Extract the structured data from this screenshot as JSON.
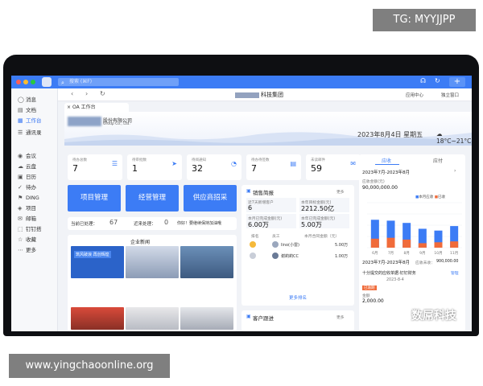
{
  "overlay": {
    "tg_label": "TG: MYYJJPP",
    "site_url": "www.yingchaoonline.org",
    "watermark_text": "数屌科技"
  },
  "titlebar": {
    "search_placeholder": "搜索 (⌘F)",
    "plus_label": "+",
    "accent_color": "#3c7cf5"
  },
  "sidebar": {
    "items": [
      {
        "label": "消息",
        "icon": "message-icon"
      },
      {
        "label": "文档",
        "icon": "document-icon"
      },
      {
        "label": "工作台",
        "icon": "workbench-icon",
        "active": true
      },
      {
        "label": "通讯录",
        "icon": "contacts-icon"
      },
      {
        "label": "会议",
        "icon": "meeting-icon"
      },
      {
        "label": "云盘",
        "icon": "cloud-icon"
      },
      {
        "label": "日历",
        "icon": "calendar-icon"
      },
      {
        "label": "待办",
        "icon": "todo-icon"
      },
      {
        "label": "DING",
        "icon": "ding-icon"
      },
      {
        "label": "项目",
        "icon": "project-icon"
      },
      {
        "label": "邮箱",
        "icon": "mail-icon"
      },
      {
        "label": "钉钉搭",
        "icon": "builder-icon"
      },
      {
        "label": "收藏",
        "icon": "star-icon"
      },
      {
        "label": "更多",
        "icon": "more-icon"
      }
    ]
  },
  "navbar": {
    "title": "科技集团",
    "app_center": "应用中心",
    "toggle_label": "独立窗口"
  },
  "tab": {
    "label": "OA 工作台"
  },
  "banner": {
    "company_name": "股份有限公司",
    "company_sub": "Group Co., Ltd.",
    "date": "2023年8月4日 星期五",
    "weather": "18°C~21°C"
  },
  "stats": [
    {
      "label": "待办总数",
      "value": "7"
    },
    {
      "label": "待审批数",
      "value": "1"
    },
    {
      "label": "待阅通知",
      "value": "32"
    },
    {
      "label": "待办待签数",
      "value": "7"
    },
    {
      "label": "未读邮件",
      "value": "59"
    }
  ],
  "buttons": {
    "project": "项目管理",
    "operation": "经营管理",
    "supplier": "供应商招采"
  },
  "todo_bar": {
    "done_label": "当前已处理：",
    "done_value": "67",
    "recent_label": "近来处理：",
    "recent_value": "0",
    "tip": "你好！要继续保持加油哦"
  },
  "news": {
    "title": "企业新闻",
    "banner_text": "筑风破浪 再创辉煌"
  },
  "sales": {
    "title": "销售简报",
    "more": "更多",
    "new_customers_label": "近7天新增客户",
    "new_customers_value": "6",
    "target_label": "本年目标金额(元)",
    "target_value": "2212.50亿",
    "month_done_label": "本月已完成金额(元)",
    "month_done_value": "6.00万",
    "year_done_label": "本年已完成金额(元)",
    "year_done_value": "5.00万",
    "rank_header": {
      "rank": "排名",
      "staff": "员工",
      "amount": "本月合同金额（元）"
    },
    "ranks": [
      {
        "name": "lino(小雷)",
        "amount": "5.00万"
      },
      {
        "name": "谢莉莉CC",
        "amount": "1.00万"
      }
    ],
    "more_rank": "更多排名"
  },
  "customer": {
    "title": "客户跟进",
    "more": "更多"
  },
  "receivable": {
    "tabs": [
      "应收",
      "应付"
    ],
    "period": "2023年7月-2023年8月",
    "total_label": "应收金额(元)",
    "total_value": "90,000,000.00",
    "legend": [
      "本月应收",
      "已收"
    ],
    "period2": "2023年7月-2023年8月",
    "unreceived_label": "应收未收：",
    "unreceived_value": "900,000.00",
    "item_title": "十分提交的应收单据-钉钉财务",
    "item_manage": "管理",
    "item_meta": "2023-8-4",
    "item_badge": "已逾期",
    "item_amount_label": "金额",
    "item_amount": "2,000.00"
  },
  "chart_data": {
    "type": "bar",
    "categories": [
      "6月",
      "7月",
      "8月",
      "9月",
      "10月",
      "11月"
    ],
    "series": [
      {
        "name": "本月应收",
        "values": [
          62,
          60,
          55,
          42,
          38,
          48
        ],
        "color": "#3c7cf5"
      },
      {
        "name": "已收",
        "values": [
          20,
          22,
          18,
          10,
          12,
          14
        ],
        "color": "#f06b3a"
      }
    ],
    "ylim": [
      0,
      100
    ]
  }
}
